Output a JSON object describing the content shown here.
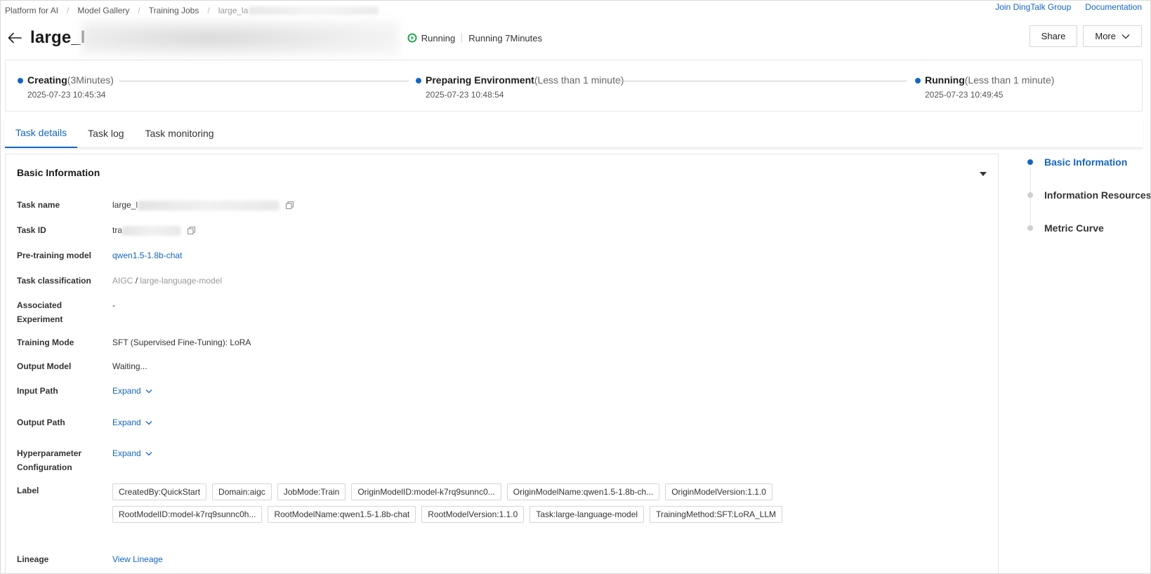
{
  "breadcrumb": {
    "items": [
      "Platform for AI",
      "Model Gallery",
      "Training Jobs",
      "large_la"
    ]
  },
  "top_links": {
    "dingtalk": "Join DingTalk Group",
    "docs": "Documentation"
  },
  "header": {
    "title": "large_l",
    "status": "Running",
    "duration": "Running 7Minutes",
    "share_label": "Share",
    "more_label": "More"
  },
  "progress": {
    "stages": [
      {
        "name": "Creating",
        "duration": "(3Minutes)",
        "time": "2025-07-23 10:45:34"
      },
      {
        "name": "Preparing Environment",
        "duration": "(Less than 1 minute)",
        "time": "2025-07-23 10:48:54"
      },
      {
        "name": "Running",
        "duration": "(Less than 1 minute)",
        "time": "2025-07-23 10:49:45"
      }
    ]
  },
  "tabs": [
    "Task details",
    "Task log",
    "Task monitoring"
  ],
  "basic_info": {
    "title": "Basic Information",
    "task_name_label": "Task name",
    "task_name_value": "large_l",
    "task_id_label": "Task ID",
    "task_id_value": "tra",
    "pretrain_label": "Pre-training model",
    "pretrain_value": "qwen1.5-1.8b-chat",
    "classification_label": "Task classification",
    "classification_a": "AIGC",
    "classification_sep": "/",
    "classification_b": "large-language-model",
    "experiment_label_1": "Associated",
    "experiment_label_2": "Experiment",
    "experiment_value": "-",
    "training_mode_label": "Training Mode",
    "training_mode_value": "SFT (Supervised Fine-Tuning): LoRA",
    "output_model_label": "Output Model",
    "output_model_value": "Waiting...",
    "input_path_label": "Input Path",
    "output_path_label": "Output Path",
    "hyper_label_1": "Hyperparameter",
    "hyper_label_2": "Configuration",
    "expand_label": "Expand",
    "label_label": "Label",
    "labels": [
      "CreatedBy:QuickStart",
      "Domain:aigc",
      "JobMode:Train",
      "OriginModelID:model-k7rq9sunnc0...",
      "OriginModelName:qwen1.5-1.8b-ch...",
      "OriginModelVersion:1.1.0",
      "RootModelID:model-k7rq9sunnc0h...",
      "RootModelName:qwen1.5-1.8b-chat",
      "RootModelVersion:1.1.0",
      "Task:large-language-model",
      "TrainingMethod:SFT:LoRA_LLM"
    ],
    "lineage_label": "Lineage",
    "lineage_value": "View Lineage"
  },
  "anchor_nav": [
    "Basic Information",
    "Information Resources",
    "Metric Curve"
  ],
  "colors": {
    "accent": "#1366c2",
    "running_green": "#19a547"
  }
}
